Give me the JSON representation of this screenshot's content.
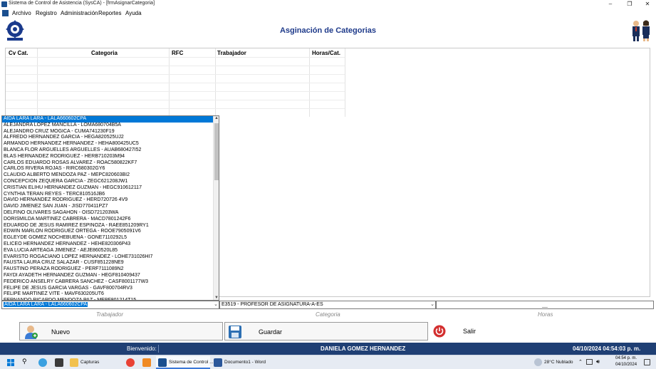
{
  "window": {
    "title": "Sistema de Control de Asistencia (SysCA) - [frmAsignarCategoria]",
    "minimize": "–",
    "restore": "❐",
    "close": "✕"
  },
  "menu": {
    "items": [
      "Archivo",
      "Registro",
      "Administración",
      "Reportes",
      "Ayuda"
    ]
  },
  "header": {
    "title": "Asginación de Categorias"
  },
  "grid": {
    "columns": [
      "Cv Cat.",
      "Categoria",
      "RFC",
      "Trabajador",
      "Horas/Cat."
    ]
  },
  "dropdown": {
    "items": [
      "AIDA LARA LARA - LALA660602CPA",
      "ALEJANDRA  LOPEZ MANCILLA - LOMA680704B5A",
      "ALEJANDRO CRUZ MOGICA - CUMA741230F19",
      "ALFREDO HERNANDEZ GARCIA - HEGA820525UJ2",
      "ARMANDO HERNANDEZ HERNANDEZ - HEHA800425UC5",
      "BLANCA  FLOR ARGUELLES ARGUELLES - AUAB680427I52",
      "BLAS HERNANDEZ RODRIGUEZ - HERB710203M94",
      "CARLOS  EDUARDO ROSAS ALVAREZ - ROAC580822KF7",
      "CARLOS RIVERA ROJAS - RIRC680302GY6",
      "CLAUDIO ALBERTO MENDOZA PAZ - MEPC820603BI2",
      "CONCEPCION  ZEQUERA GARCIA - ZEGC621208JW1",
      "CRISTIAN ELIHU HERNANDEZ GUZMAN - HEGC910612117",
      "CYNTHIA TERAN REYES - TERC810516JB6",
      "DAVID HERNANDEZ RODRIGUEZ - HERD720726 4V9",
      "DAVID JIMENEZ SAN  JUAN - JISD770411PZ7",
      "DELFINO   OLIVARES SAGAHON - OISD721203WA",
      "DORISMILDA MARTINEZ CABRERA - MACD7801242F6",
      "EDUARDO  DE JESUS RAMIREZ  ESPINOZA  - RAEE851209RY1",
      "EDWIN MARLON RODRIGUEZ  ORTEGA - ROOE7905091V6",
      "EGLEYDE GOMEZ NOCHEBUENA - GONE7110292L5",
      "ELICEO HERNANDEZ HERNANDEZ - HEHE820306P43",
      "EVA  LUCIA ARTEAGA JIMENEZ - AEJE860520L85",
      "EVARISTO  ROGACIANO LOPEZ HERNANDEZ - LOHE731026HI7",
      "FAUSTA  LAURA CRUZ SALAZAR - CUSF851228NE9",
      "FAUSTINO PERAZA RODRIGUEZ - PERF7111089N2",
      "FAYDI  AYADETH HERNANDEZ GUZMAN - HEGF810409437",
      "FEDERICO ANSELRY CABRERA SANCHEZ  - CASF8001177W3",
      "FELIPE  DE JESUS GARCIA VARGAS - GAVF800704RV3",
      "FELIPE MARTINEZ VITE - MAVF630205UT6",
      "FERNANDO  RICARDO MENDOZA PAZ - MEPF801214T15"
    ],
    "selected_index": 0
  },
  "inputs": {
    "trabajador_value": "AIDA LARA LARA - LALA660602CPA",
    "categoria_value": "E3519 - PROFESOR DE ASIGNATURA-A-ES",
    "horas_value": "",
    "horas_dash": "__",
    "trabajador_caption": "Trabajador",
    "categoria_caption": "Categoria",
    "horas_caption": "Horas"
  },
  "buttons": {
    "nuevo": "Nuevo",
    "guardar": "Guardar",
    "salir": "Salir"
  },
  "status": {
    "bienvenido": "Bienvenido:",
    "user": "DANIELA GOMEZ HERNANDEZ",
    "datetime": "04/10/2024 04:54:03 p. m."
  },
  "taskbar": {
    "apps": [
      "Capturas",
      "Sistema de Control ...",
      "Documento1 - Word"
    ],
    "weather": "28°C  Nublado",
    "time": "04:54 p. m.",
    "date": "04/10/2024"
  },
  "colors": {
    "accent": "#1f3f74",
    "title": "#1e3a8a",
    "selection": "#0078d7",
    "exit": "#d32f2f"
  }
}
